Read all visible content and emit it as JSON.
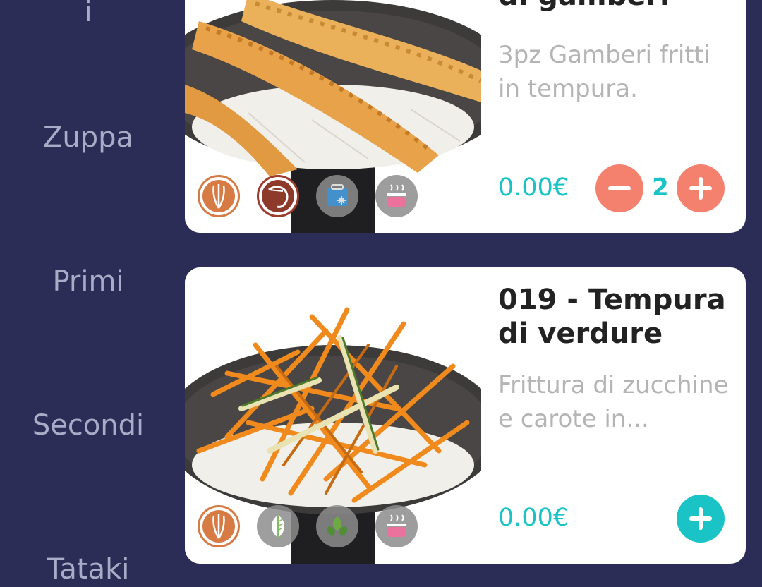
{
  "sidebar": {
    "categories": [
      {
        "label": "i"
      },
      {
        "label": "Zuppa"
      },
      {
        "label": "Primi"
      },
      {
        "label": "Secondi"
      },
      {
        "label": "Tataki"
      }
    ]
  },
  "items": [
    {
      "title": "di gamberi",
      "description_line1": "3pz Gamberi fritti",
      "description_line2": "in tempura.",
      "price": "0.00€",
      "quantity": "2",
      "badges": [
        "wheat-icon",
        "shrimp-icon",
        "frozen-icon",
        "steam-pot-icon"
      ]
    },
    {
      "title_line1": "019 - Tempura",
      "title_line2": "di verdure",
      "description_line1": "Frittura di zucchine",
      "description_line2": "e carote in...",
      "price": "0.00€",
      "badges": [
        "wheat-icon",
        "leaf-icon",
        "vegan-leaves-icon",
        "steam-pot-icon"
      ]
    }
  ],
  "colors": {
    "background": "#2b2d57",
    "accent_teal": "#19c3c6",
    "accent_salmon": "#f4806e",
    "card": "#ffffff"
  }
}
